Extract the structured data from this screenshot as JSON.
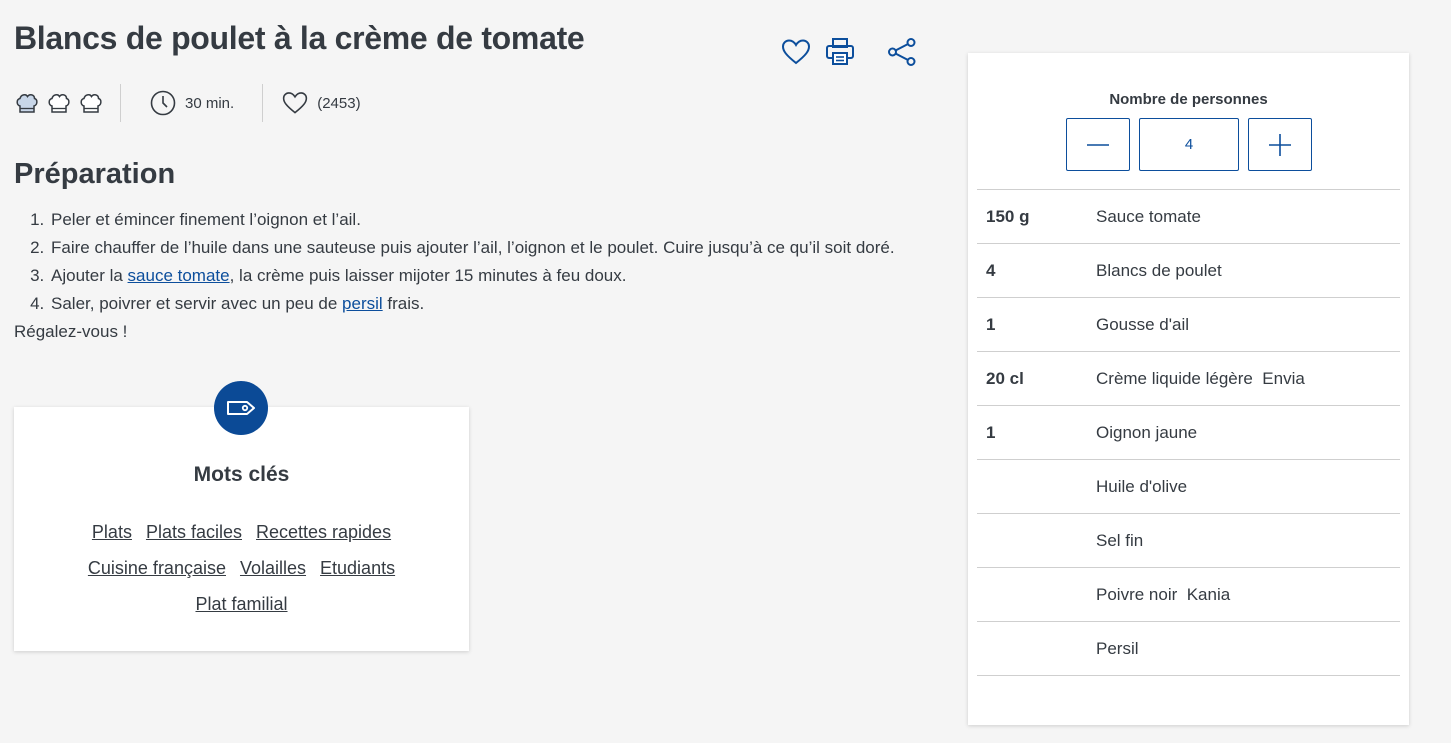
{
  "recipe": {
    "title": "Blancs de poulet à la crème de tomate",
    "time": "30 min.",
    "likes": "(2453)"
  },
  "icons": {
    "favorite": "heart-outline-icon",
    "print": "printer-icon",
    "share": "share-icon",
    "difficulty": "chef-hat-icon",
    "time": "clock-icon",
    "likes": "heart-outline-icon",
    "keywords": "tag-icon",
    "minus": "minus-icon",
    "plus": "plus-icon"
  },
  "difficulty": {
    "filled": 1,
    "total": 3
  },
  "preparation": {
    "heading": "Préparation",
    "steps": [
      {
        "text": "Peler et émincer finement l’oignon et l’ail."
      },
      {
        "text": "Faire chauffer de l’huile dans une sauteuse puis ajouter l’ail, l’oignon et le poulet. Cuire jusqu’à ce qu’il soit doré."
      },
      {
        "before": "Ajouter la ",
        "link": "sauce tomate",
        "after": ", la crème puis laisser mijoter 15 minutes à feu doux."
      },
      {
        "before": "Saler, poivrer et servir avec un peu de ",
        "link": "persil",
        "after": " frais."
      }
    ],
    "closing": "Régalez-vous !"
  },
  "keywords": {
    "heading": "Mots clés",
    "items": [
      "Plats",
      "Plats faciles",
      "Recettes rapides",
      "Cuisine française",
      "Volailles",
      "Etudiants",
      "Plat familial"
    ]
  },
  "servings": {
    "label": "Nombre de personnes",
    "value": "4"
  },
  "ingredients": [
    {
      "qty": "150 g",
      "name": "Sauce tomate"
    },
    {
      "qty": "4",
      "name": "Blancs de poulet"
    },
    {
      "qty": "1",
      "name": "Gousse d'ail"
    },
    {
      "qty": "20 cl",
      "name": "Crème liquide légère  Envia"
    },
    {
      "qty": "1",
      "name": "Oignon jaune"
    },
    {
      "qty": "",
      "name": "Huile d'olive"
    },
    {
      "qty": "",
      "name": "Sel fin"
    },
    {
      "qty": "",
      "name": "Poivre noir  Kania"
    },
    {
      "qty": "",
      "name": "Persil"
    }
  ],
  "colors": {
    "accent": "#0c4e9c",
    "text": "#353b42",
    "hat_filled": "#c8d6e8"
  }
}
